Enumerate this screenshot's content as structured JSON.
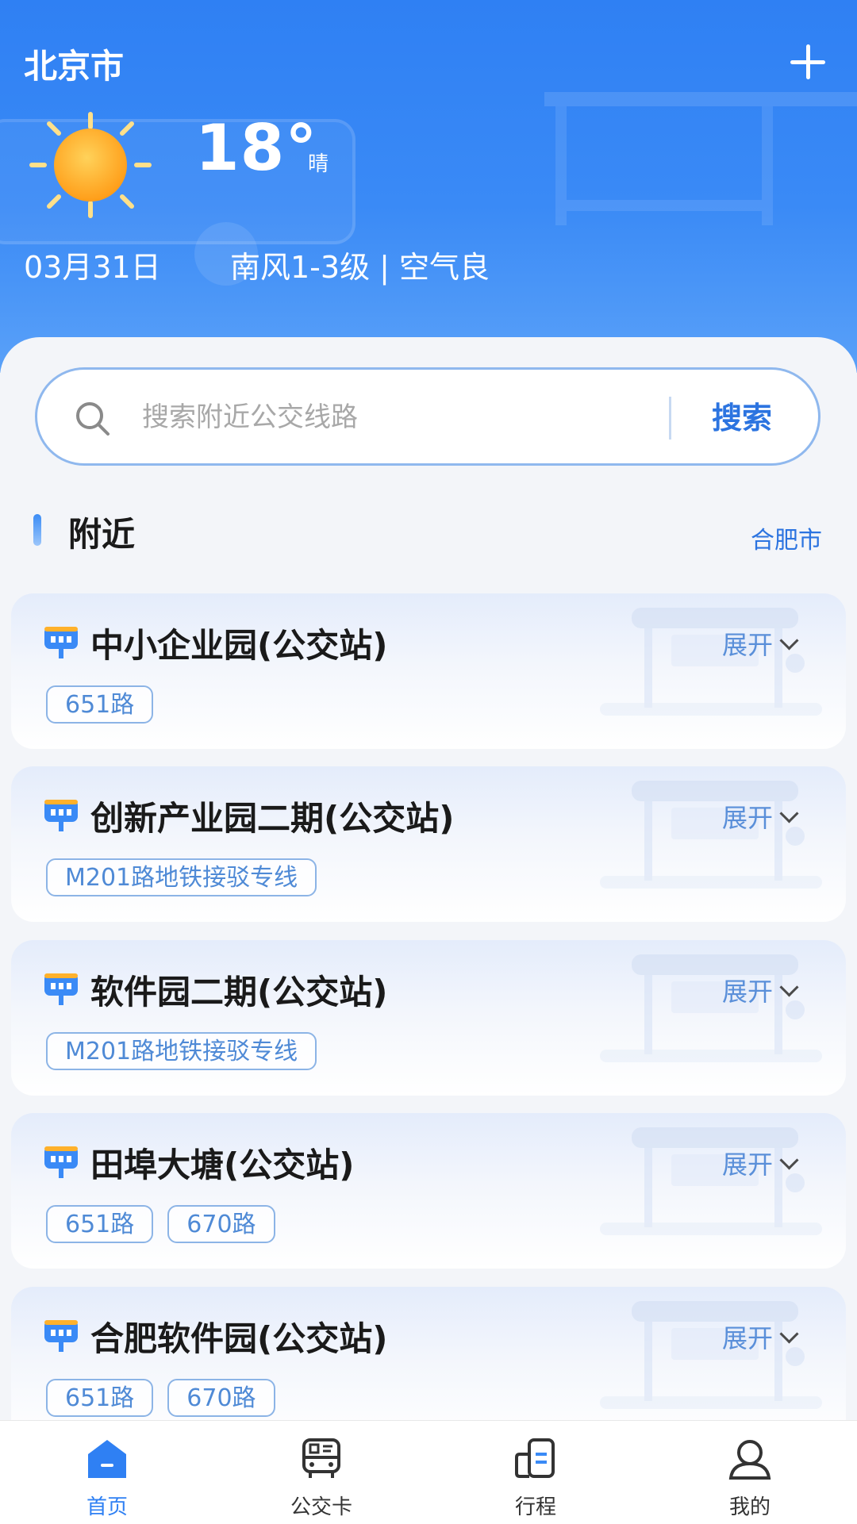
{
  "header": {
    "city": "北京市",
    "temperature": "18°",
    "weather": "晴",
    "date": "03月31日",
    "wind_air": "南风1-3级 | 空气良"
  },
  "search": {
    "placeholder": "搜索附近公交线路",
    "button_label": "搜索"
  },
  "nearby": {
    "title": "附近",
    "city": "合肥市",
    "expand_label": "展开",
    "stations": [
      {
        "name": "中小企业园(公交站)",
        "routes": [
          "651路"
        ]
      },
      {
        "name": "创新产业园二期(公交站)",
        "routes": [
          "M201路地铁接驳专线"
        ]
      },
      {
        "name": "软件园二期(公交站)",
        "routes": [
          "M201路地铁接驳专线"
        ]
      },
      {
        "name": "田埠大塘(公交站)",
        "routes": [
          "651路",
          "670路"
        ]
      },
      {
        "name": "合肥软件园(公交站)",
        "routes": [
          "651路",
          "670路"
        ]
      }
    ]
  },
  "bottom_nav": [
    {
      "label": "首页",
      "icon": "home-icon",
      "active": true
    },
    {
      "label": "公交卡",
      "icon": "bus-card-icon",
      "active": false
    },
    {
      "label": "行程",
      "icon": "trip-icon",
      "active": false
    },
    {
      "label": "我的",
      "icon": "profile-icon",
      "active": false
    }
  ],
  "colors": {
    "primary": "#2f80f3",
    "accent_text": "#2c74e0",
    "tag_border": "#8cb4e6"
  }
}
